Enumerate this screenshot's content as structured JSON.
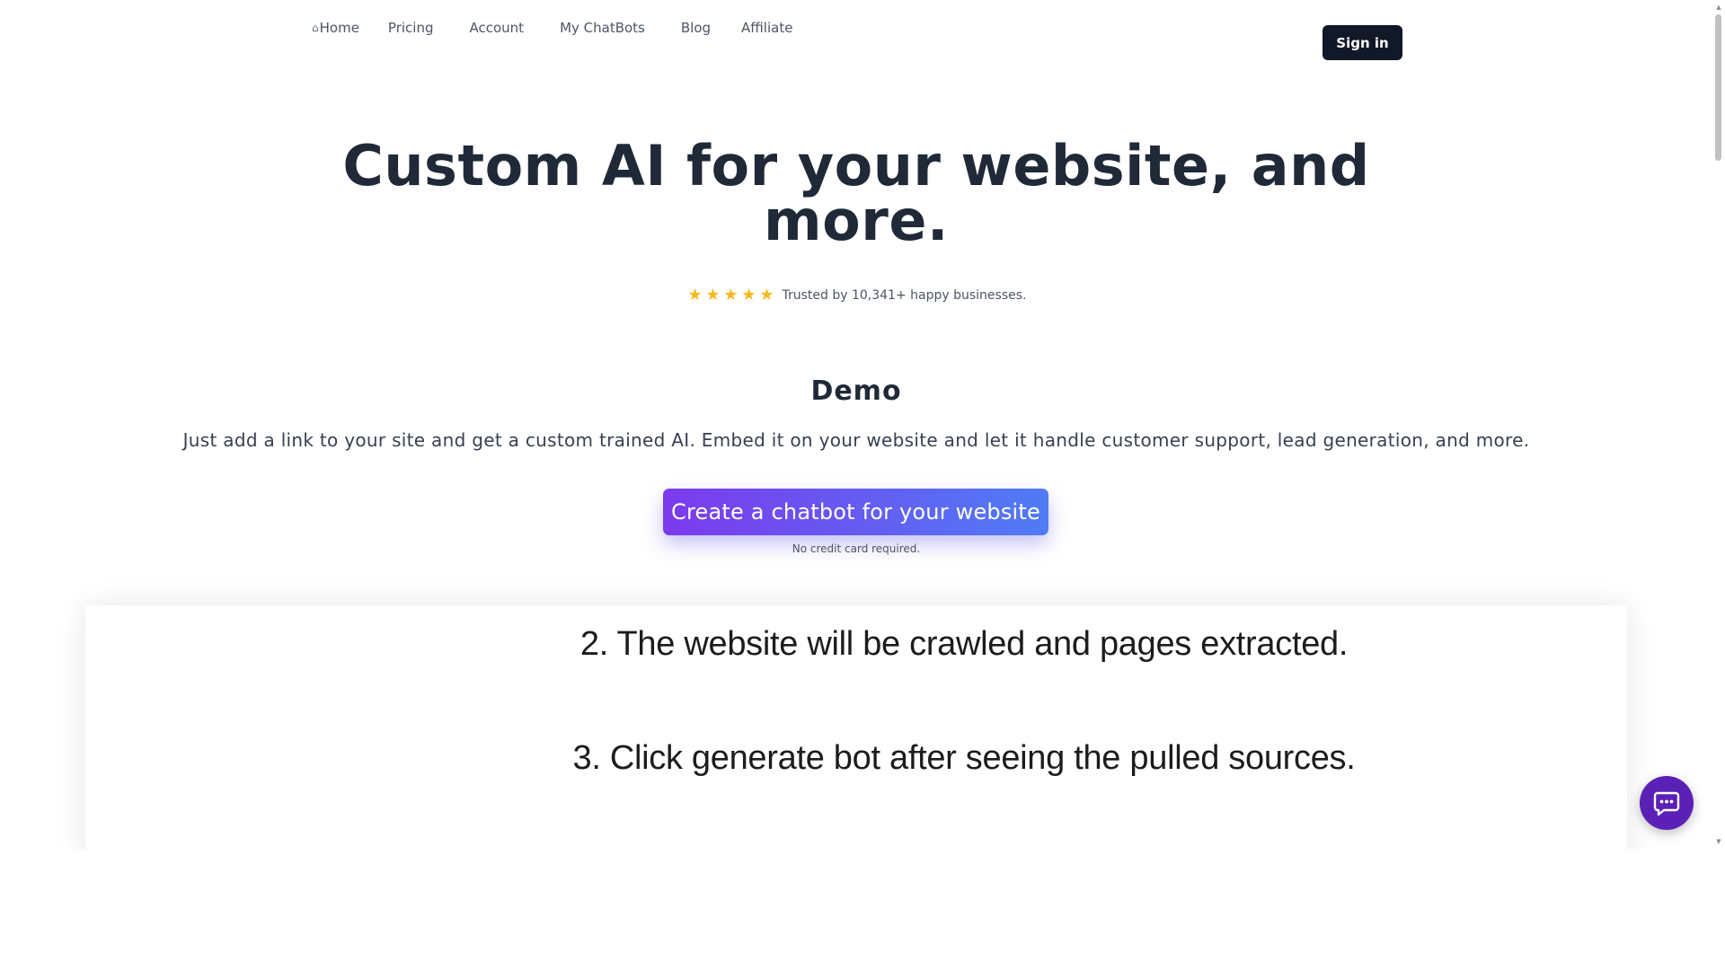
{
  "nav": {
    "items": [
      {
        "label": "Home",
        "icon": "home-icon"
      },
      {
        "label": "Pricing"
      },
      {
        "label": "Account"
      },
      {
        "label": "My ChatBots"
      },
      {
        "label": "Blog"
      },
      {
        "label": "Affiliate"
      }
    ],
    "signin_label": "Sign in"
  },
  "hero": {
    "title_line1": "Custom AI for your website, and",
    "title_line2": "more.",
    "rating_stars": 5,
    "rating_text": "Trusted by 10,341+ happy businesses."
  },
  "demo": {
    "title": "Demo",
    "description": "Just add a link to your site and get a custom trained AI. Embed it on your website and let it handle customer support, lead generation, and more.",
    "cta_label": "Create a chatbot for your website",
    "note": "No credit card required."
  },
  "video": {
    "steps": [
      "2. The website will be crawled and pages extracted.",
      "3. Click generate bot after seeing the pulled sources."
    ]
  },
  "chat_widget": {
    "icon": "chat-bubble-icon",
    "color": "#5b21b6"
  },
  "colors": {
    "primary_dark": "#111827",
    "cta_gradient_start": "#7c3aed",
    "cta_gradient_end": "#4f7cf5",
    "star": "#f5b91f"
  }
}
